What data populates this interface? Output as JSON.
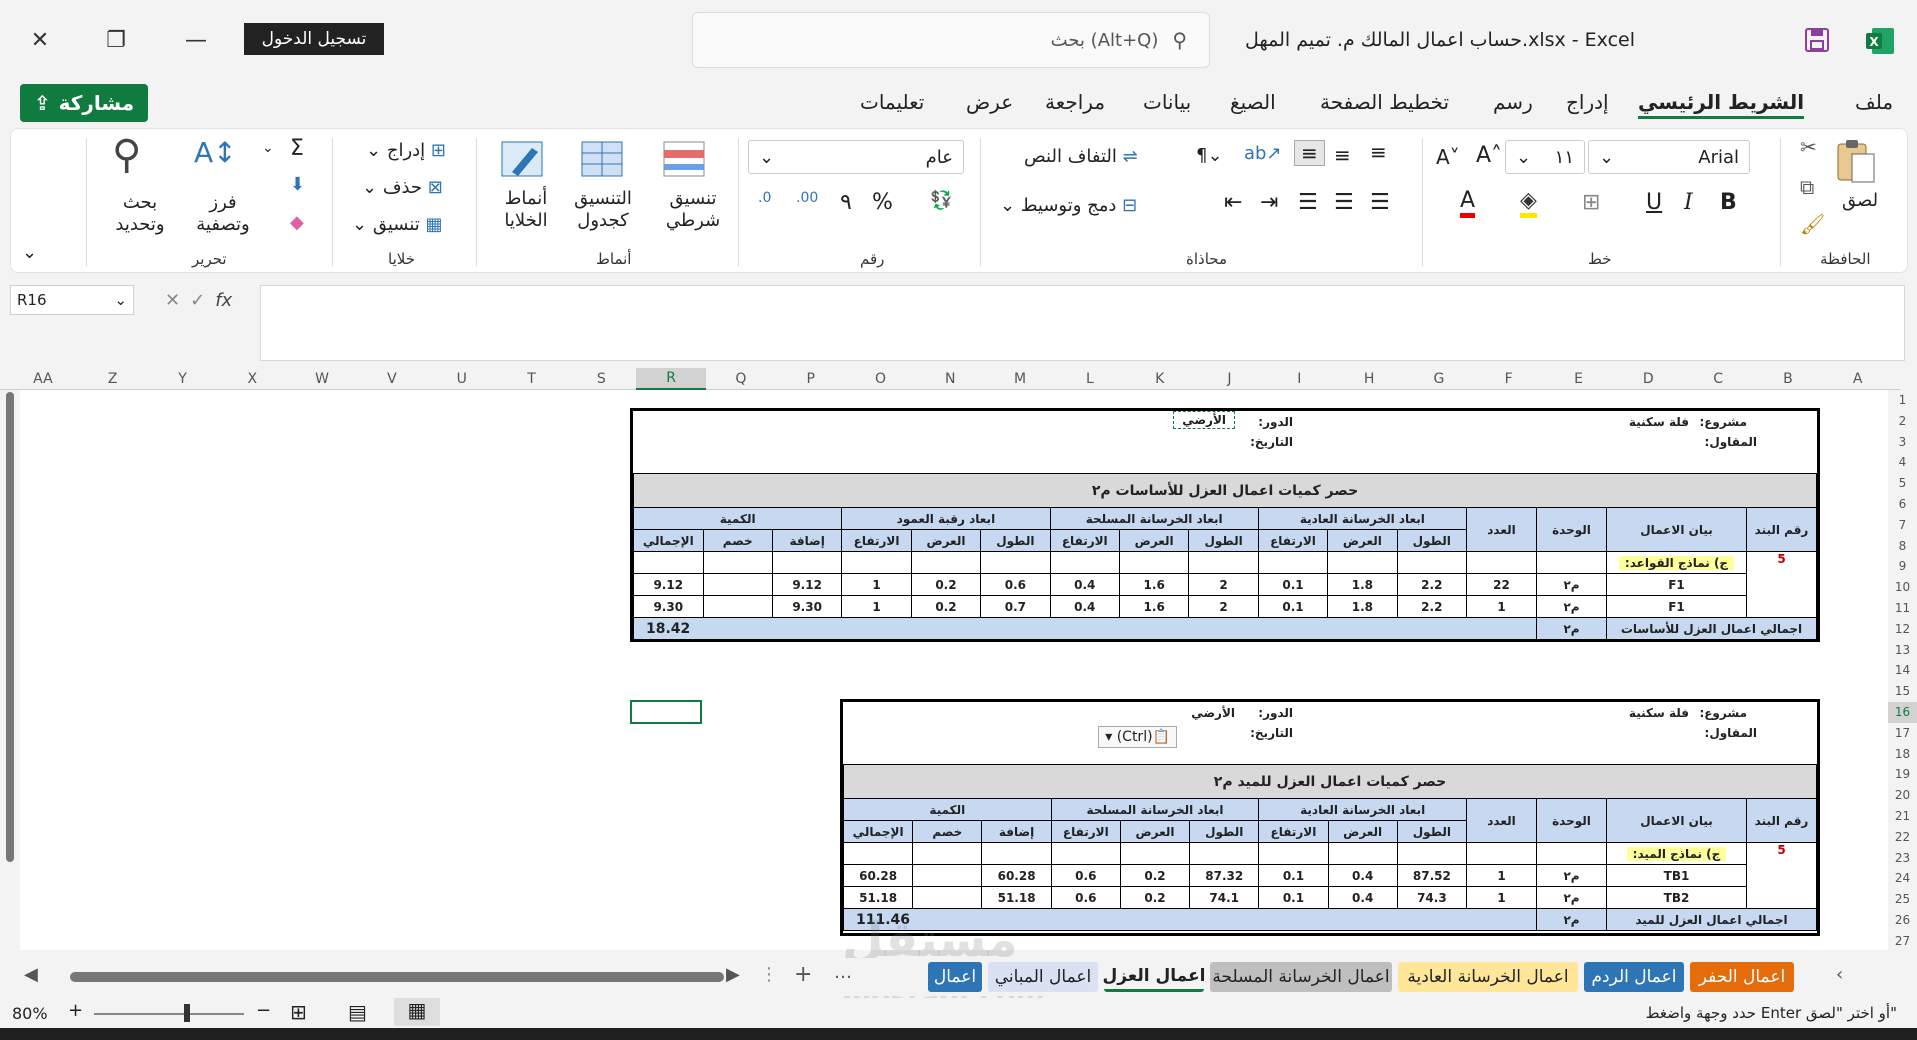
{
  "window": {
    "title": "حساب اعمال المالك م. تميم المهل.xlsx  -  Excel",
    "signin": "تسجيل الدخول",
    "search_placeholder": "بحث (Alt+Q)"
  },
  "menu": {
    "share": "مشاركة",
    "tabs": [
      "ملف",
      "الشريط الرئيسي",
      "إدراج",
      "رسم",
      "تخطيط الصفحة",
      "الصيغ",
      "بيانات",
      "مراجعة",
      "عرض",
      "تعليمات"
    ],
    "active": "الشريط الرئيسي"
  },
  "ribbon": {
    "clipboard": {
      "label": "الحافظة",
      "paste": "لصق"
    },
    "font": {
      "label": "خط",
      "name": "Arial",
      "size": "١١"
    },
    "alignment": {
      "label": "محاذاة",
      "wrap": "التفاف النص",
      "merge": "دمج وتوسيط"
    },
    "number": {
      "label": "رقم",
      "format": "عام"
    },
    "styles": {
      "label": "أنماط",
      "conditional": "تنسيق شرطي",
      "table": "التنسيق كجدول",
      "cell": "أنماط الخلايا"
    },
    "cells": {
      "label": "خلايا",
      "insert": "إدراج",
      "delete": "حذف",
      "format": "تنسيق"
    },
    "editing": {
      "label": "تحرير",
      "sort": "فرز وتصفية",
      "find": "بحث وتحديد"
    }
  },
  "formula": {
    "namebox": "R16",
    "value": ""
  },
  "columns": [
    "AA",
    "Z",
    "Y",
    "X",
    "W",
    "V",
    "U",
    "T",
    "S",
    "R",
    "Q",
    "P",
    "O",
    "N",
    "M",
    "L",
    "K",
    "J",
    "I",
    "H",
    "G",
    "F",
    "E",
    "D",
    "C",
    "B",
    "A"
  ],
  "rows": [
    "1",
    "2",
    "3",
    "4",
    "5",
    "6",
    "7",
    "8",
    "9",
    "10",
    "11",
    "12",
    "13",
    "14",
    "15",
    "16",
    "17",
    "18",
    "19",
    "20",
    "21",
    "22",
    "23",
    "24",
    "25",
    "26",
    "27"
  ],
  "table1": {
    "project_label": "مشروع:",
    "project": "فلة سكنية",
    "contractor_label": "المقاول:",
    "floor_label": "الدور:",
    "floor": "الأرضي",
    "date_label": "التاريخ:",
    "title": "حصر كميات اعمال العزل للأساسات م٢",
    "h_item": "رقم البند",
    "h_desc": "بيان الاعمال",
    "h_unit": "الوحدة",
    "h_count": "العدد",
    "h_plain": "ابعاد الخرسانة العادية",
    "h_rc": "ابعاد الخرسانة المسلحة",
    "h_neck": "ابعاد رقبة العمود",
    "h_qty": "الكمية",
    "h_len": "الطول",
    "h_wid": "العرض",
    "h_hgt": "الارتفاع",
    "h_add": "إضافة",
    "h_ded": "خصم",
    "h_total": "الإجمالي",
    "item_no": "5",
    "group": "ج) نماذج القواعد:",
    "rows": [
      {
        "desc": "F1",
        "unit": "م٢",
        "count": "22",
        "pl": "2.2",
        "pw": "1.8",
        "ph": "0.1",
        "rl": "2",
        "rw": "1.6",
        "rh": "0.4",
        "nl": "0.6",
        "nw": "0.2",
        "nh": "1",
        "add": "9.12",
        "ded": "",
        "total": "9.12"
      },
      {
        "desc": "F1",
        "unit": "م٢",
        "count": "1",
        "pl": "2.2",
        "pw": "1.8",
        "ph": "0.1",
        "rl": "2",
        "rw": "1.6",
        "rh": "0.4",
        "nl": "0.7",
        "nw": "0.2",
        "nh": "1",
        "add": "9.30",
        "ded": "",
        "total": "9.30"
      }
    ],
    "total_label": "اجمالي اعمال العزل للأساسات",
    "total_unit": "م٢",
    "total": "18.42"
  },
  "table2": {
    "project_label": "مشروع:",
    "project": "فلة سكنية",
    "contractor_label": "المقاول:",
    "floor_label": "الدور:",
    "floor": "الأرضي",
    "date_label": "التاريخ:",
    "title": "حصر كميات اعمال العزل للميد م٢",
    "item_no": "5",
    "group": "ج) نماذج الميد:",
    "rows": [
      {
        "desc": "TB1",
        "unit": "م٢",
        "count": "1",
        "pl": "87.52",
        "pw": "0.4",
        "ph": "0.1",
        "rl": "87.32",
        "rw": "0.2",
        "rh": "0.6",
        "add": "60.28",
        "ded": "",
        "total": "60.28"
      },
      {
        "desc": "TB2",
        "unit": "م٢",
        "count": "1",
        "pl": "74.3",
        "pw": "0.4",
        "ph": "0.1",
        "rl": "74.1",
        "rw": "0.2",
        "rh": "0.6",
        "add": "51.18",
        "ded": "",
        "total": "51.18"
      }
    ],
    "total_label": "اجمالي اعمال العزل للميد",
    "total_unit": "م٢",
    "total": "111.46",
    "paste_ctrl": "(Ctrl)"
  },
  "sheet_tabs": [
    {
      "label": "اعمال الحفر",
      "color": "#e46c0a",
      "text": "#fff"
    },
    {
      "label": "اعمال الردم",
      "color": "#2e75b6",
      "text": "#fff"
    },
    {
      "label": "اعمال الخرسانة العادية",
      "color": "#ffe699",
      "text": "#222"
    },
    {
      "label": "اعمال الخرسانة المسلحة",
      "color": "#bfbfbf",
      "text": "#222"
    },
    {
      "label": "اعمال العزل",
      "color": "#f3f3f3",
      "text": "#222"
    },
    {
      "label": "اعمال المباني",
      "color": "#d9e1f2",
      "text": "#222"
    },
    {
      "label": "اعمال",
      "color": "#2e75b6",
      "text": "#fff"
    }
  ],
  "status": {
    "message": "حدد وجهة واضغط Enter أو اختر \"لصق\"",
    "zoom": "80%"
  },
  "watermark": {
    "text": "مستقل",
    "sub": "mostaql.com"
  }
}
